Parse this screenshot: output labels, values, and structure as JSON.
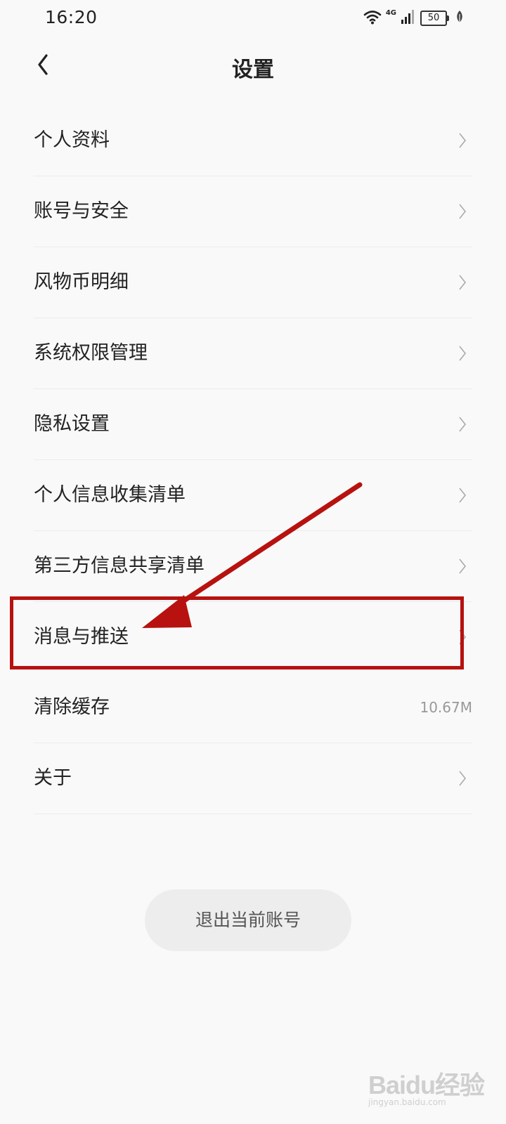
{
  "status_bar": {
    "time": "16:20",
    "network": "4G",
    "battery": "50",
    "icons": [
      "wifi-icon",
      "signal-icon",
      "battery-icon",
      "leaf-icon"
    ]
  },
  "header": {
    "title": "设置",
    "back_icon": "chevron-left-icon"
  },
  "settings": {
    "items": [
      {
        "label": "个人资料",
        "icon": "chevron-right-icon"
      },
      {
        "label": "账号与安全",
        "icon": "chevron-right-icon"
      },
      {
        "label": "风物币明细",
        "icon": "chevron-right-icon"
      },
      {
        "label": "系统权限管理",
        "icon": "chevron-right-icon"
      },
      {
        "label": "隐私设置",
        "icon": "chevron-right-icon"
      },
      {
        "label": "个人信息收集清单",
        "icon": "chevron-right-icon"
      },
      {
        "label": "第三方信息共享清单",
        "icon": "chevron-right-icon"
      },
      {
        "label": "消息与推送",
        "icon": "chevron-right-icon",
        "highlighted": true
      },
      {
        "label": "清除缓存",
        "value": "10.67M"
      },
      {
        "label": "关于",
        "icon": "chevron-right-icon"
      }
    ]
  },
  "logout": {
    "label": "退出当前账号"
  },
  "annotation": {
    "color": "#b7120f"
  },
  "watermark": {
    "logo": "Baidu经验",
    "sub": "jingyan.baidu.com"
  }
}
